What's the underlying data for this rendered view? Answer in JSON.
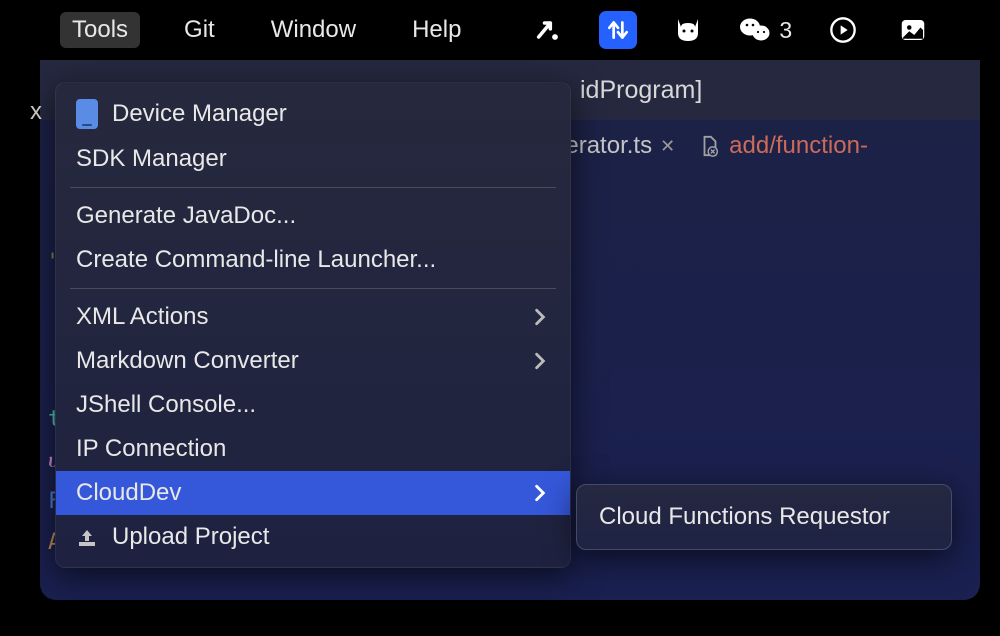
{
  "menubar": {
    "items": [
      {
        "label": "Tools",
        "active": true
      },
      {
        "label": "Git",
        "active": false
      },
      {
        "label": "Window",
        "active": false
      },
      {
        "label": "Help",
        "active": false
      }
    ]
  },
  "tray": {
    "count": "3"
  },
  "window": {
    "title_fragment": "idProgram]"
  },
  "tabs": [
    {
      "label": "Generator.ts",
      "modified": false
    },
    {
      "label": "add/function-",
      "modified": true
    }
  ],
  "gutter": [
    {
      "char": "\"",
      "cls": "green"
    },
    {
      "char": "",
      "cls": ""
    },
    {
      "char": "t",
      "cls": "cyan"
    },
    {
      "char": "ሀ",
      "cls": "purple"
    },
    {
      "char": "F",
      "cls": "blue"
    },
    {
      "char": "A",
      "cls": "orange"
    }
  ],
  "dropdown": {
    "items": [
      {
        "label": "Device Manager",
        "icon": "device",
        "submenu": false
      },
      {
        "label": "SDK Manager",
        "icon": null,
        "submenu": false
      },
      {
        "divider": true
      },
      {
        "label": "Generate JavaDoc...",
        "icon": null,
        "submenu": false
      },
      {
        "label": "Create Command-line Launcher...",
        "icon": null,
        "submenu": false
      },
      {
        "divider": true
      },
      {
        "label": "XML Actions",
        "icon": null,
        "submenu": true
      },
      {
        "label": "Markdown Converter",
        "icon": null,
        "submenu": true
      },
      {
        "label": "JShell Console...",
        "icon": null,
        "submenu": false
      },
      {
        "label": "IP Connection",
        "icon": null,
        "submenu": false
      },
      {
        "label": "CloudDev",
        "icon": null,
        "submenu": true,
        "selected": true
      },
      {
        "label": "Upload Project",
        "icon": "upload",
        "submenu": false
      }
    ]
  },
  "submenu": {
    "items": [
      {
        "label": "Cloud Functions Requestor"
      }
    ]
  }
}
